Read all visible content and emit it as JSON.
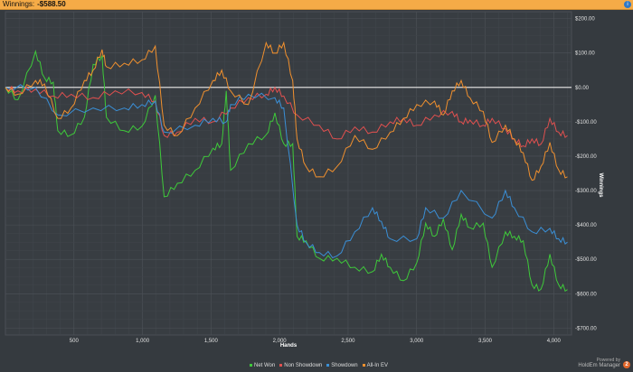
{
  "header": {
    "label": "Winnings:",
    "value": "-$588.50",
    "info_icon": "info-icon"
  },
  "legend": [
    {
      "label": "Net Won",
      "color": "#3ec93a"
    },
    {
      "label": "Non Showdown",
      "color": "#e0504f"
    },
    {
      "label": "Showdown",
      "color": "#3a8fd6"
    },
    {
      "label": "All-In EV",
      "color": "#f0902e"
    }
  ],
  "branding": {
    "line1": "Powered by",
    "line2": "HoldEm Manager",
    "badge": "2"
  },
  "chart_data": {
    "type": "line",
    "title": "",
    "xlabel": "Hands",
    "ylabel": "Winnings",
    "xlim": [
      0,
      4130
    ],
    "ylim": [
      -720,
      220
    ],
    "x_ticks": [
      500,
      1000,
      1500,
      2000,
      2500,
      3000,
      3500,
      4000
    ],
    "x_tick_labels": [
      "500",
      "1,000",
      "1,500",
      "2,000",
      "2,500",
      "3,000",
      "3,500",
      "4,000"
    ],
    "y_ticks": [
      200,
      100,
      0,
      -100,
      -200,
      -300,
      -400,
      -500,
      -600,
      -700
    ],
    "y_tick_labels": [
      "$200.00",
      "$100.00",
      "$0.00",
      "-$100.00",
      "-$200.00",
      "-$300.00",
      "-$400.00",
      "-$500.00",
      "-$600.00",
      "-$700.00"
    ],
    "grid": true,
    "legend_position": "bottom",
    "series": [
      {
        "name": "Net Won",
        "color": "#3ec93a",
        "x": [
          0,
          91,
          220,
          285,
          349,
          382,
          479,
          576,
          640,
          705,
          737,
          867,
          996,
          1093,
          1158,
          1255,
          1384,
          1514,
          1578,
          1611,
          1643,
          1772,
          1902,
          1966,
          2031,
          2096,
          2128,
          2193,
          2290,
          2419,
          2549,
          2678,
          2743,
          2807,
          2904,
          3001,
          3066,
          3131,
          3195,
          3260,
          3325,
          3389,
          3486,
          3551,
          3648,
          3713,
          3778,
          3842,
          3907,
          3972,
          4036,
          4100
        ],
        "y": [
          0,
          -36,
          105,
          28,
          15,
          -126,
          -138,
          -87,
          67,
          92,
          -87,
          -126,
          -113,
          -23,
          -318,
          -279,
          -241,
          -177,
          -164,
          -10,
          -241,
          -164,
          -138,
          -74,
          -164,
          -164,
          -433,
          -446,
          -497,
          -497,
          -523,
          -536,
          -485,
          -523,
          -562,
          -510,
          -395,
          -433,
          -382,
          -472,
          -369,
          -408,
          -395,
          -523,
          -420,
          -433,
          -446,
          -574,
          -587,
          -485,
          -574,
          -588
        ]
      },
      {
        "name": "Non Showdown",
        "color": "#e0504f",
        "x": [
          0,
          91,
          220,
          349,
          480,
          640,
          800,
          996,
          1093,
          1158,
          1255,
          1384,
          1514,
          1643,
          1772,
          1902,
          1966,
          2031,
          2128,
          2290,
          2419,
          2549,
          2678,
          2807,
          2904,
          3001,
          3131,
          3260,
          3325,
          3389,
          3486,
          3551,
          3648,
          3713,
          3778,
          3842,
          3907,
          3972,
          4036,
          4100
        ],
        "y": [
          0,
          -10,
          -5,
          -25,
          -20,
          -30,
          -10,
          -15,
          -40,
          -140,
          -130,
          -90,
          -100,
          -60,
          -30,
          -20,
          0,
          -25,
          -80,
          -110,
          -150,
          -115,
          -130,
          -100,
          -90,
          -110,
          -80,
          -70,
          -100,
          -95,
          -110,
          -90,
          -120,
          -150,
          -170,
          -150,
          -165,
          -90,
          -130,
          -140
        ]
      },
      {
        "name": "Showdown",
        "color": "#3a8fd6",
        "x": [
          0,
          220,
          382,
          640,
          867,
          996,
          1093,
          1158,
          1384,
          1514,
          1611,
          1643,
          1772,
          1966,
          2031,
          2128,
          2193,
          2290,
          2419,
          2549,
          2678,
          2743,
          2807,
          3001,
          3066,
          3195,
          3325,
          3551,
          3648,
          3713,
          3842,
          3972,
          4036,
          4100
        ],
        "y": [
          0,
          0,
          -80,
          -60,
          -60,
          -50,
          -40,
          -130,
          -110,
          -90,
          -100,
          -50,
          -20,
          -30,
          -60,
          -400,
          -450,
          -480,
          -490,
          -420,
          -350,
          -390,
          -440,
          -440,
          -350,
          -380,
          -300,
          -380,
          -300,
          -350,
          -420,
          -410,
          -440,
          -450
        ]
      },
      {
        "name": "All-In EV",
        "color": "#f0902e",
        "x": [
          0,
          91,
          220,
          285,
          382,
          479,
          576,
          640,
          705,
          737,
          867,
          996,
          1093,
          1158,
          1255,
          1384,
          1514,
          1578,
          1643,
          1772,
          1902,
          1966,
          2031,
          2096,
          2128,
          2193,
          2290,
          2419,
          2549,
          2678,
          2807,
          2904,
          3001,
          3131,
          3195,
          3260,
          3325,
          3389,
          3486,
          3551,
          3648,
          3713,
          3778,
          3842,
          3907,
          3972,
          4036,
          4100
        ],
        "y": [
          0,
          -20,
          20,
          10,
          -90,
          -60,
          20,
          50,
          110,
          60,
          70,
          80,
          120,
          -110,
          -140,
          -60,
          20,
          50,
          -10,
          -50,
          130,
          100,
          130,
          20,
          -150,
          -230,
          -260,
          -230,
          -140,
          -180,
          -130,
          -90,
          -50,
          -40,
          -80,
          -10,
          20,
          -30,
          -70,
          -160,
          -110,
          -150,
          -190,
          -270,
          -230,
          -160,
          -240,
          -260
        ]
      }
    ]
  }
}
